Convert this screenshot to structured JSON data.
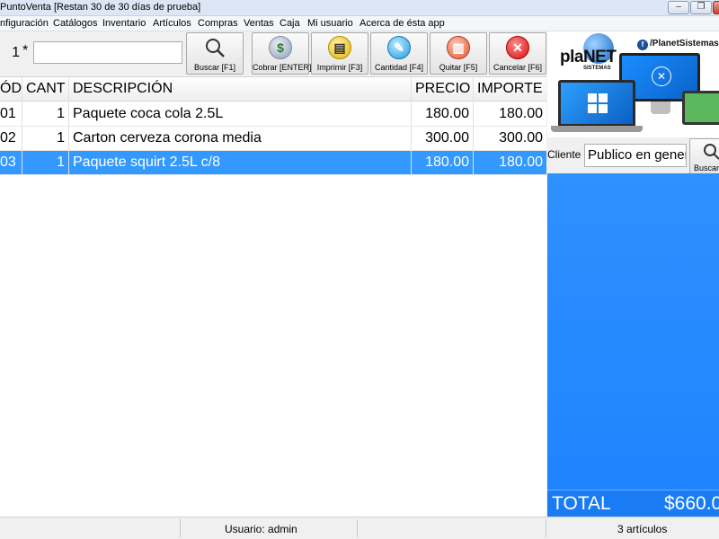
{
  "window": {
    "title": "PuntoVenta [Restan 30 de 30 días de prueba]"
  },
  "menu": [
    "nfiguración",
    "Catálogos",
    "Inventario",
    "Artículos",
    "Compras",
    "Ventas",
    "Caja",
    "Mi usuario",
    "Acerca de ésta app"
  ],
  "entry": {
    "quantity": "1",
    "multiplier": "*",
    "code_value": ""
  },
  "toolbar": {
    "buscar": "Buscar [F1]",
    "cobrar": "Cobrar [ENTER]",
    "imprimir": "Imprimir [F3]",
    "cantidad": "Cantidad [F4]",
    "quitar": "Quitar [F5]",
    "cancelar": "Cancelar [F6]"
  },
  "table": {
    "headers": {
      "code": "ÓD",
      "qty": "CANT",
      "desc": "DESCRIPCIÓN",
      "price": "PRECIO",
      "amount": "IMPORTE"
    },
    "rows": [
      {
        "code": "01",
        "qty": "1",
        "desc": "Paquete coca cola 2.5L",
        "price": "180.00",
        "amount": "180.00"
      },
      {
        "code": "02",
        "qty": "1",
        "desc": "Carton cerveza corona media",
        "price": "300.00",
        "amount": "300.00"
      },
      {
        "code": "03",
        "qty": "1",
        "desc": "Paquete squirt 2.5L c/8",
        "price": "180.00",
        "amount": "180.00"
      }
    ]
  },
  "brand": {
    "name": "plaNET",
    "sub": "SISTEMAS",
    "social_handle": "/PlanetSistemas"
  },
  "customer": {
    "label": "Cliente",
    "value": "Publico en general",
    "search_label": "Buscar"
  },
  "total": {
    "label": "TOTAL",
    "value": "$660.00"
  },
  "status": {
    "user": "Usuario: admin",
    "items": "3 artículos"
  },
  "colors": {
    "selected_row": "#3399ff",
    "panel_blue": "#2d91ff"
  }
}
